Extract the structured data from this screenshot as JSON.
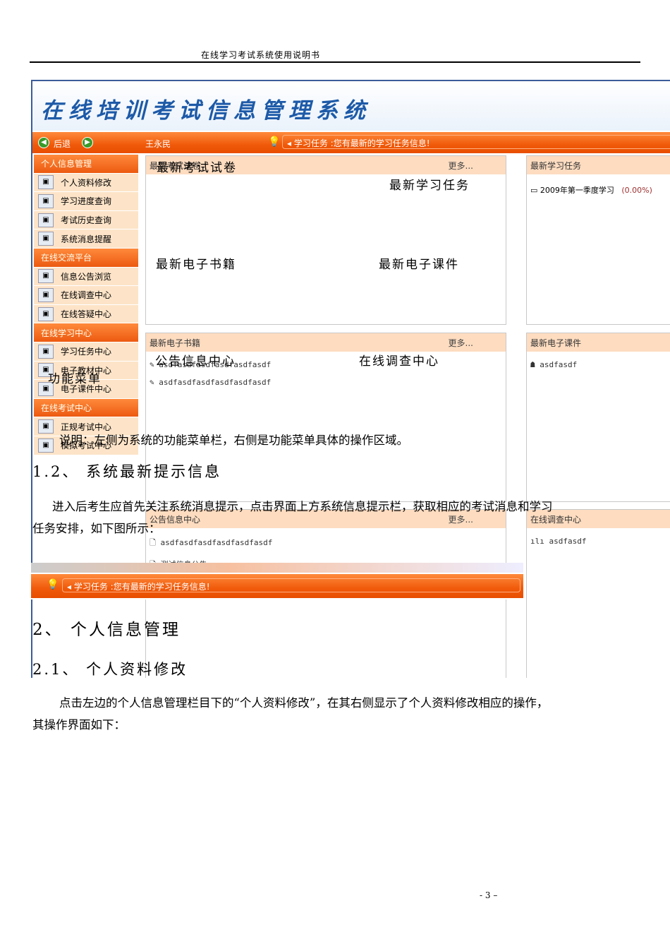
{
  "doc": {
    "header": "在线学习考试系统使用说明书",
    "page_number": "- 3 –"
  },
  "app": {
    "title": "在线培训考试信息管理系统",
    "back": "后退",
    "user": "王永民",
    "message": "学习任务 :您有最新的学习任务信息!",
    "sidebar": [
      {
        "label": "个人信息管理",
        "type": "h"
      },
      {
        "label": "个人资料修改",
        "type": "s"
      },
      {
        "label": "学习进度查询",
        "type": "s"
      },
      {
        "label": "考试历史查询",
        "type": "s"
      },
      {
        "label": "系统消息提醒",
        "type": "s"
      },
      {
        "label": "在线交流平台",
        "type": "h"
      },
      {
        "label": "信息公告浏览",
        "type": "s"
      },
      {
        "label": "在线调查中心",
        "type": "s"
      },
      {
        "label": "在线答疑中心",
        "type": "s"
      },
      {
        "label": "在线学习中心",
        "type": "h"
      },
      {
        "label": "学习任务中心",
        "type": "s"
      },
      {
        "label": "电子教材中心",
        "type": "s"
      },
      {
        "label": "电子课件中心",
        "type": "s"
      },
      {
        "label": "在线考试中心",
        "type": "h"
      },
      {
        "label": "正规考试中心",
        "type": "s"
      },
      {
        "label": "模拟考试中心",
        "type": "s"
      }
    ],
    "more": "更多...",
    "panels": {
      "exam": {
        "title": "最新考试试卷"
      },
      "task": {
        "title": "最新学习任务",
        "item": "2009年第一季度学习",
        "progress": "(0.00%)"
      },
      "books": {
        "title": "最新电子书籍",
        "items": [
          "asdfasdfasdfasdfasdfasdf",
          "asdfasdfasdfasdfasdfasdf"
        ]
      },
      "courseware": {
        "title": "最新电子课件",
        "item": "asdfasdf"
      },
      "notice": {
        "title": "公告信息中心",
        "items": [
          "asdfasdfasdfasdfasdfasdf",
          "测试信息公告"
        ]
      },
      "survey": {
        "title": "在线调查中心",
        "item": "asdfasdf"
      }
    }
  },
  "annotations": {
    "exam": "最新考试试卷",
    "task": "最新学习任务",
    "books": "最新电子书籍",
    "courseware": "最新电子课件",
    "notice": "公告信息中心",
    "survey": "在线调查中心",
    "menu": "功能菜单"
  },
  "body": {
    "note": "说明：左侧为系统的功能菜单栏，右侧是功能菜单具体的操作区域。",
    "h12": "1.2、  系统最新提示信息",
    "p12a": "进入后考生应首先关注系统消息提示，点击界面上方系统信息提示栏，获取相应的考试消息和学习",
    "p12b": "任务安排，如下图所示：",
    "h2": "2、  个人信息管理",
    "h21": "2.1、  个人资料修改",
    "p21a": "点击左边的个人信息管理栏目下的“个人资料修改”，在其右侧显示了个人资料修改相应的操作，",
    "p21b": "其操作界面如下："
  }
}
